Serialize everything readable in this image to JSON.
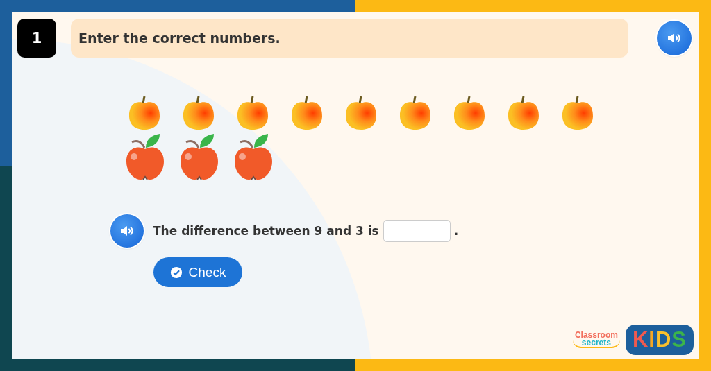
{
  "question_number": "1",
  "instruction": "Enter the correct numbers.",
  "fruit_rows": [
    {
      "items": [
        {
          "kind": "peach"
        },
        {
          "kind": "peach"
        },
        {
          "kind": "peach"
        },
        {
          "kind": "peach"
        },
        {
          "kind": "peach"
        },
        {
          "kind": "peach"
        },
        {
          "kind": "peach"
        },
        {
          "kind": "peach"
        },
        {
          "kind": "peach"
        }
      ]
    },
    {
      "items": [
        {
          "kind": "apple"
        },
        {
          "kind": "apple"
        },
        {
          "kind": "apple"
        }
      ]
    }
  ],
  "question": {
    "text_before": "The difference between 9 and 3 is",
    "text_after": "."
  },
  "check_button": "Check",
  "logo": {
    "line_1": "Classroom",
    "line_2": "secrets",
    "badge": "KIDS"
  }
}
